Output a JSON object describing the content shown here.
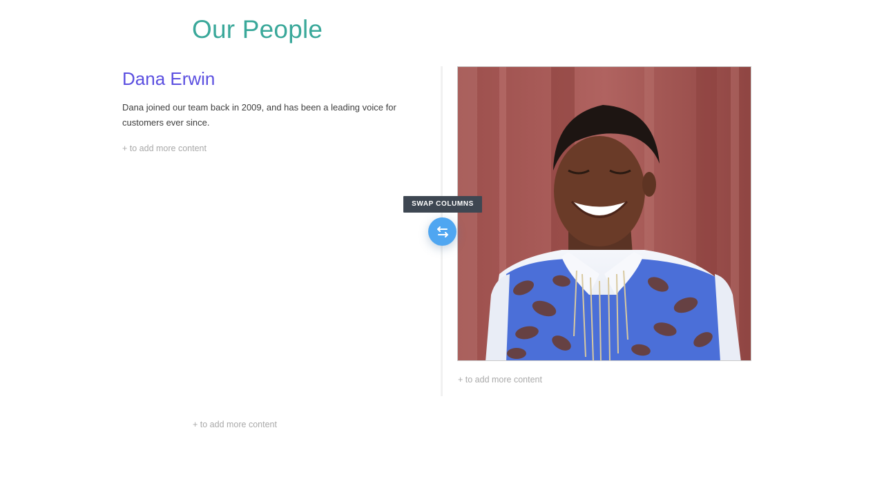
{
  "section": {
    "title": "Our People"
  },
  "person": {
    "name": "Dana Erwin",
    "bio": "Dana joined our team back in 2009, and has been a leading voice for customers ever since."
  },
  "add_content_label": "+ to add more content",
  "swap": {
    "tooltip": "SWAP COLUMNS",
    "icon": "swap-arrows-icon"
  },
  "colors": {
    "title": "#3aa89a",
    "name": "#5b4fe0",
    "swap_button": "#4fa6f1",
    "tooltip_bg": "#3e4752",
    "placeholder_text": "#a9a9a9"
  }
}
